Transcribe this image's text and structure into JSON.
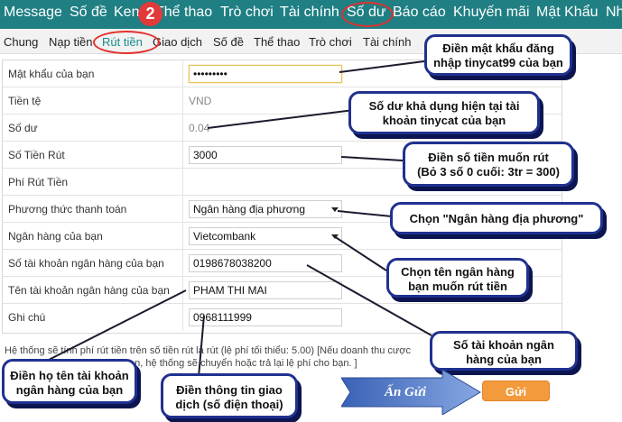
{
  "top_nav": {
    "items": [
      "Message",
      "Số đề",
      "Keno",
      "Thể thao",
      "Trò chơi",
      "Tài chính",
      "Số dư",
      "Báo cáo",
      "Khuyến mãi",
      "Mật Khẩu",
      "Nhà"
    ],
    "active": "Số dư",
    "step_badge": "2"
  },
  "sub_nav": {
    "items": [
      "Chung",
      "Nạp tiền",
      "Rút tiền",
      "Giao dịch",
      "Số đề",
      "Thể thao",
      "Trò chơi",
      "Tài chính"
    ],
    "active": "Rút tiền"
  },
  "form": {
    "rows": [
      {
        "label": "Mật khẩu của bạn",
        "type": "password",
        "value": "•••••••••"
      },
      {
        "label": "Tiền tệ",
        "type": "text",
        "value": "VND"
      },
      {
        "label": "Số dư",
        "type": "text",
        "value": "0.04"
      },
      {
        "label": "Số Tiền Rút",
        "type": "input",
        "value": "3000"
      },
      {
        "label": "Phí Rút Tiền",
        "type": "text",
        "value": ""
      },
      {
        "label": "Phương thức thanh toán",
        "type": "select",
        "value": "Ngân hàng địa phương"
      },
      {
        "label": "Ngân hàng của bạn",
        "type": "select",
        "value": "Vietcombank"
      },
      {
        "label": "Số tài khoản ngân hàng của bạn",
        "type": "input",
        "value": "0198678038200"
      },
      {
        "label": "Tên tài khoản ngân hàng của bạn",
        "type": "input",
        "value": "PHAM THI MAI"
      },
      {
        "label": "Ghi chú",
        "type": "input",
        "value": "0968111999"
      }
    ]
  },
  "footnote": {
    "line1": "Hệ thống sẽ tính phí rút tiền trên số tiền rút là rút (lệ phí tối thiểu: 5.00) [Nếu doanh thu cược",
    "line2": "...n, hệ thống sẽ chuyển hoặc trả lại lệ phí cho bạn. ]"
  },
  "callouts": {
    "password": [
      "Điền mật khẩu đăng",
      "nhập tinycat99 của bạn"
    ],
    "balance": [
      "Số dư khả dụng hiện tại tài",
      "khoản tinycat của bạn"
    ],
    "amount": [
      "Điền số tiền muốn rút",
      "(Bỏ 3 số 0 cuối: 3tr = 300)"
    ],
    "method": [
      "Chọn \"Ngân hàng địa phương\""
    ],
    "bank": [
      "Chọn tên ngân hàng",
      "bạn muốn rút tiền"
    ],
    "account_no": [
      "Số tài khoản ngân",
      "hàng của bạn"
    ],
    "account_name": [
      "Điền họ tên tài khoản",
      "ngân hàng của bạn"
    ],
    "note": [
      "Điền thông tin giao",
      "dịch (số điện thoại)"
    ]
  },
  "an_gui_label": "Ấn Gửi",
  "submit_label": "Gửi",
  "colors": {
    "nav_bg": "#1f7f83",
    "callout_border": "#20318f",
    "submit_bg": "#f39a3c",
    "highlight_ring": "#e2312d"
  }
}
